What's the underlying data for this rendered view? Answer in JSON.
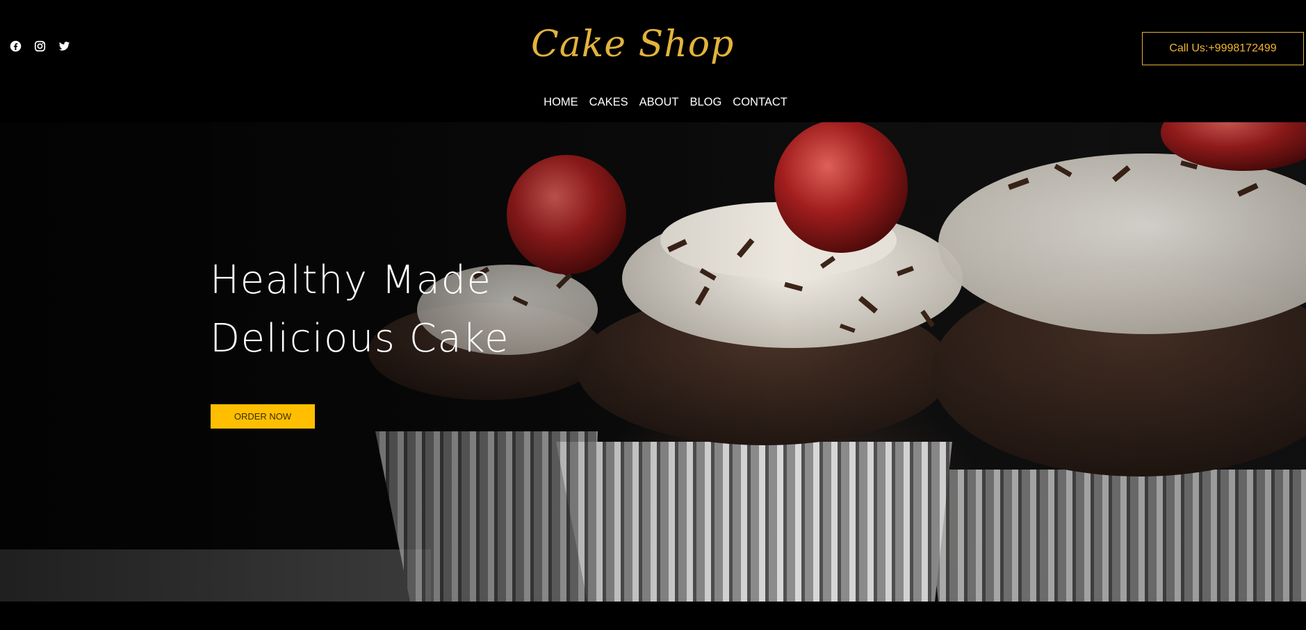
{
  "header": {
    "social": [
      {
        "name": "facebook-icon"
      },
      {
        "name": "instagram-icon"
      },
      {
        "name": "twitter-icon"
      }
    ],
    "logo_text": "Cake Shop",
    "call_label": "Call Us:+9998172499"
  },
  "nav": {
    "items": [
      "HOME",
      "CAKES",
      "ABOUT",
      "BLOG",
      "CONTACT"
    ]
  },
  "hero": {
    "title_line1": "Healthy Made",
    "title_line2": "Delicious Cake",
    "order_label": "ORDER NOW"
  },
  "colors": {
    "accent": "#e3b33c",
    "button": "#ffbf00",
    "background": "#000000"
  }
}
